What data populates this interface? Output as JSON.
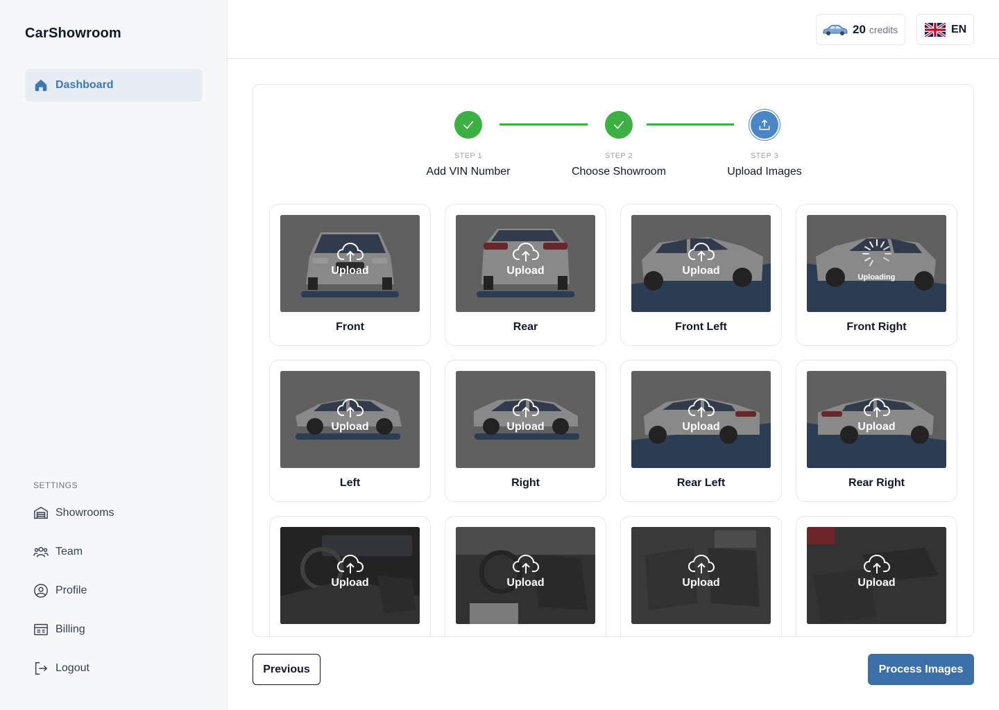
{
  "app": {
    "title": "CarShowroom"
  },
  "sidebar": {
    "active": {
      "label": "Dashboard",
      "icon": "home-icon"
    },
    "settings_label": "SETTINGS",
    "items": [
      {
        "label": "Showrooms",
        "icon": "garage-icon"
      },
      {
        "label": "Team",
        "icon": "users-icon"
      },
      {
        "label": "Profile",
        "icon": "user-circle-icon"
      },
      {
        "label": "Billing",
        "icon": "billing-icon"
      },
      {
        "label": "Logout",
        "icon": "logout-icon"
      }
    ]
  },
  "header": {
    "credits": {
      "value": "20",
      "label": "credits",
      "icon": "car-icon"
    },
    "language": {
      "code": "EN",
      "icon": "uk-flag-icon"
    }
  },
  "stepper": {
    "steps": [
      {
        "num": "STEP 1",
        "title": "Add VIN Number",
        "status": "done"
      },
      {
        "num": "STEP 2",
        "title": "Choose Showroom",
        "status": "done"
      },
      {
        "num": "STEP 3",
        "title": "Upload Images",
        "status": "current"
      }
    ]
  },
  "tiles": [
    {
      "label": "Front",
      "action": "Upload"
    },
    {
      "label": "Rear",
      "action": "Upload"
    },
    {
      "label": "Front Left",
      "action": "Upload"
    },
    {
      "label": "Front Right",
      "action": "Uploading"
    },
    {
      "label": "Left",
      "action": "Upload"
    },
    {
      "label": "Right",
      "action": "Upload"
    },
    {
      "label": "Rear Left",
      "action": "Upload"
    },
    {
      "label": "Rear Right",
      "action": "Upload"
    },
    {
      "label": "",
      "action": "Upload"
    },
    {
      "label": "",
      "action": "Upload"
    },
    {
      "label": "",
      "action": "Upload"
    },
    {
      "label": "",
      "action": "Upload"
    }
  ],
  "footer": {
    "previous": "Previous",
    "process": "Process Images"
  },
  "colors": {
    "accent": "#3b78b6",
    "success": "#3cb043",
    "primary_button": "#3b6fa8",
    "floor_blue": "#2f4f77"
  }
}
